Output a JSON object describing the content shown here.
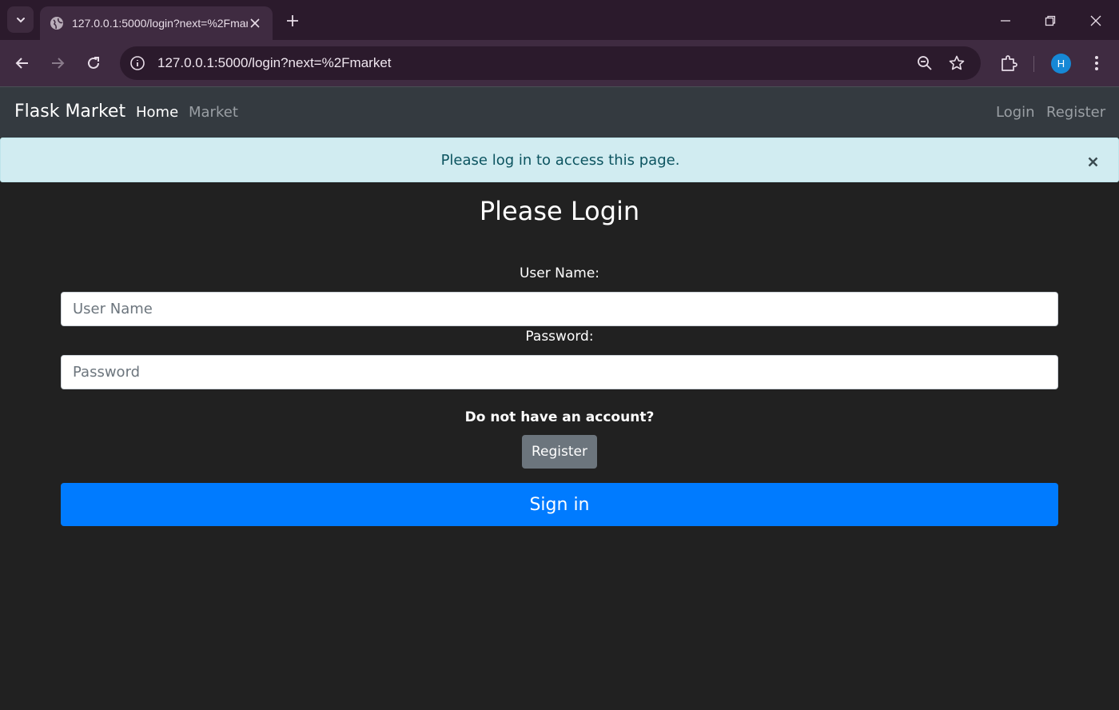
{
  "browser": {
    "tab_title": "127.0.0.1:5000/login?next=%2Fmarket",
    "url": "127.0.0.1:5000/login?next=%2Fmarket",
    "profile_initial": "H"
  },
  "navbar": {
    "brand": "Flask Market",
    "home": "Home",
    "market": "Market",
    "login": "Login",
    "register": "Register"
  },
  "alert": {
    "message": "Please log in to access this page."
  },
  "form": {
    "title": "Please Login",
    "username_label": "User Name:",
    "username_placeholder": "User Name",
    "password_label": "Password:",
    "password_placeholder": "Password",
    "no_account_text": "Do not have an account?",
    "register_button": "Register",
    "signin_button": "Sign in"
  },
  "colors": {
    "chrome_bg": "#2b1a2c",
    "toolbar_bg": "#3f2b41",
    "page_bg": "#212121",
    "navbar_bg": "#343a40",
    "alert_bg": "#d1ecf1",
    "alert_text": "#0c5460",
    "primary": "#007bff",
    "secondary": "#6c757d"
  }
}
